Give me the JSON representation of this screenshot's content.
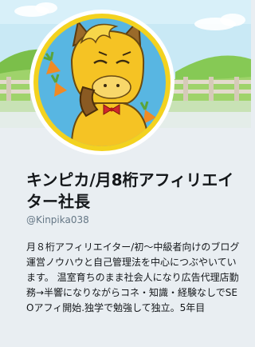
{
  "profile": {
    "display_name": "キンピカ/月8桁アフィリエイター社長",
    "handle": "@Kinpika038",
    "bio": "月８桁アフィリエイター/初〜中級者向けのブログ運営ノウハウと自己管理法を中心につぶやいています。 温室育ちのまま社会人になり広告代理店勤務→半響になりながらコネ・知識・経験なしでSEOアフィ開始.独学で勉強して独立。5年目"
  },
  "colors": {
    "sky": "#c7e8f4",
    "hill": "#7fc24e",
    "fence": "#d9d0c2",
    "avatar_bg": "#58b6e2",
    "mascot": "#f5c324",
    "page_bg": "#e9eef2"
  }
}
